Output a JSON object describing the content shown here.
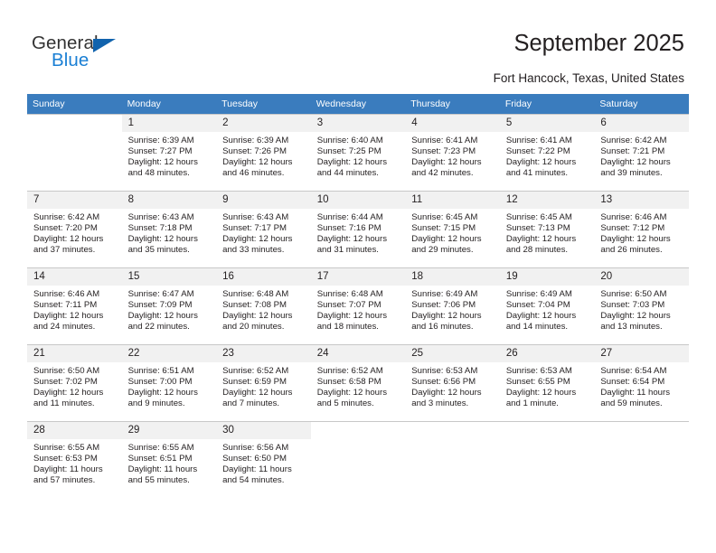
{
  "logo": {
    "word_one": "General",
    "word_two": "Blue",
    "icon": "triangle-logo-mark"
  },
  "header": {
    "title": "September 2025",
    "subtitle": "Fort Hancock, Texas, United States"
  },
  "colors": {
    "header_row_bg": "#3a7cbe",
    "daynum_bg": "#f1f1f1",
    "brand_blue": "#1a7fd4",
    "text": "#231f20"
  },
  "weekdays": [
    "Sunday",
    "Monday",
    "Tuesday",
    "Wednesday",
    "Thursday",
    "Friday",
    "Saturday"
  ],
  "labels": {
    "sunrise": "Sunrise:",
    "sunset": "Sunset:",
    "daylight": "Daylight:"
  },
  "weeks": [
    [
      {
        "day": "",
        "sunrise": "",
        "sunset": "",
        "daylight_a": "",
        "daylight_b": "",
        "empty": true
      },
      {
        "day": "1",
        "sunrise": "Sunrise: 6:39 AM",
        "sunset": "Sunset: 7:27 PM",
        "daylight_a": "Daylight: 12 hours",
        "daylight_b": "and 48 minutes."
      },
      {
        "day": "2",
        "sunrise": "Sunrise: 6:39 AM",
        "sunset": "Sunset: 7:26 PM",
        "daylight_a": "Daylight: 12 hours",
        "daylight_b": "and 46 minutes."
      },
      {
        "day": "3",
        "sunrise": "Sunrise: 6:40 AM",
        "sunset": "Sunset: 7:25 PM",
        "daylight_a": "Daylight: 12 hours",
        "daylight_b": "and 44 minutes."
      },
      {
        "day": "4",
        "sunrise": "Sunrise: 6:41 AM",
        "sunset": "Sunset: 7:23 PM",
        "daylight_a": "Daylight: 12 hours",
        "daylight_b": "and 42 minutes."
      },
      {
        "day": "5",
        "sunrise": "Sunrise: 6:41 AM",
        "sunset": "Sunset: 7:22 PM",
        "daylight_a": "Daylight: 12 hours",
        "daylight_b": "and 41 minutes."
      },
      {
        "day": "6",
        "sunrise": "Sunrise: 6:42 AM",
        "sunset": "Sunset: 7:21 PM",
        "daylight_a": "Daylight: 12 hours",
        "daylight_b": "and 39 minutes."
      }
    ],
    [
      {
        "day": "7",
        "sunrise": "Sunrise: 6:42 AM",
        "sunset": "Sunset: 7:20 PM",
        "daylight_a": "Daylight: 12 hours",
        "daylight_b": "and 37 minutes."
      },
      {
        "day": "8",
        "sunrise": "Sunrise: 6:43 AM",
        "sunset": "Sunset: 7:18 PM",
        "daylight_a": "Daylight: 12 hours",
        "daylight_b": "and 35 minutes."
      },
      {
        "day": "9",
        "sunrise": "Sunrise: 6:43 AM",
        "sunset": "Sunset: 7:17 PM",
        "daylight_a": "Daylight: 12 hours",
        "daylight_b": "and 33 minutes."
      },
      {
        "day": "10",
        "sunrise": "Sunrise: 6:44 AM",
        "sunset": "Sunset: 7:16 PM",
        "daylight_a": "Daylight: 12 hours",
        "daylight_b": "and 31 minutes."
      },
      {
        "day": "11",
        "sunrise": "Sunrise: 6:45 AM",
        "sunset": "Sunset: 7:15 PM",
        "daylight_a": "Daylight: 12 hours",
        "daylight_b": "and 29 minutes."
      },
      {
        "day": "12",
        "sunrise": "Sunrise: 6:45 AM",
        "sunset": "Sunset: 7:13 PM",
        "daylight_a": "Daylight: 12 hours",
        "daylight_b": "and 28 minutes."
      },
      {
        "day": "13",
        "sunrise": "Sunrise: 6:46 AM",
        "sunset": "Sunset: 7:12 PM",
        "daylight_a": "Daylight: 12 hours",
        "daylight_b": "and 26 minutes."
      }
    ],
    [
      {
        "day": "14",
        "sunrise": "Sunrise: 6:46 AM",
        "sunset": "Sunset: 7:11 PM",
        "daylight_a": "Daylight: 12 hours",
        "daylight_b": "and 24 minutes."
      },
      {
        "day": "15",
        "sunrise": "Sunrise: 6:47 AM",
        "sunset": "Sunset: 7:09 PM",
        "daylight_a": "Daylight: 12 hours",
        "daylight_b": "and 22 minutes."
      },
      {
        "day": "16",
        "sunrise": "Sunrise: 6:48 AM",
        "sunset": "Sunset: 7:08 PM",
        "daylight_a": "Daylight: 12 hours",
        "daylight_b": "and 20 minutes."
      },
      {
        "day": "17",
        "sunrise": "Sunrise: 6:48 AM",
        "sunset": "Sunset: 7:07 PM",
        "daylight_a": "Daylight: 12 hours",
        "daylight_b": "and 18 minutes."
      },
      {
        "day": "18",
        "sunrise": "Sunrise: 6:49 AM",
        "sunset": "Sunset: 7:06 PM",
        "daylight_a": "Daylight: 12 hours",
        "daylight_b": "and 16 minutes."
      },
      {
        "day": "19",
        "sunrise": "Sunrise: 6:49 AM",
        "sunset": "Sunset: 7:04 PM",
        "daylight_a": "Daylight: 12 hours",
        "daylight_b": "and 14 minutes."
      },
      {
        "day": "20",
        "sunrise": "Sunrise: 6:50 AM",
        "sunset": "Sunset: 7:03 PM",
        "daylight_a": "Daylight: 12 hours",
        "daylight_b": "and 13 minutes."
      }
    ],
    [
      {
        "day": "21",
        "sunrise": "Sunrise: 6:50 AM",
        "sunset": "Sunset: 7:02 PM",
        "daylight_a": "Daylight: 12 hours",
        "daylight_b": "and 11 minutes."
      },
      {
        "day": "22",
        "sunrise": "Sunrise: 6:51 AM",
        "sunset": "Sunset: 7:00 PM",
        "daylight_a": "Daylight: 12 hours",
        "daylight_b": "and 9 minutes."
      },
      {
        "day": "23",
        "sunrise": "Sunrise: 6:52 AM",
        "sunset": "Sunset: 6:59 PM",
        "daylight_a": "Daylight: 12 hours",
        "daylight_b": "and 7 minutes."
      },
      {
        "day": "24",
        "sunrise": "Sunrise: 6:52 AM",
        "sunset": "Sunset: 6:58 PM",
        "daylight_a": "Daylight: 12 hours",
        "daylight_b": "and 5 minutes."
      },
      {
        "day": "25",
        "sunrise": "Sunrise: 6:53 AM",
        "sunset": "Sunset: 6:56 PM",
        "daylight_a": "Daylight: 12 hours",
        "daylight_b": "and 3 minutes."
      },
      {
        "day": "26",
        "sunrise": "Sunrise: 6:53 AM",
        "sunset": "Sunset: 6:55 PM",
        "daylight_a": "Daylight: 12 hours",
        "daylight_b": "and 1 minute."
      },
      {
        "day": "27",
        "sunrise": "Sunrise: 6:54 AM",
        "sunset": "Sunset: 6:54 PM",
        "daylight_a": "Daylight: 11 hours",
        "daylight_b": "and 59 minutes."
      }
    ],
    [
      {
        "day": "28",
        "sunrise": "Sunrise: 6:55 AM",
        "sunset": "Sunset: 6:53 PM",
        "daylight_a": "Daylight: 11 hours",
        "daylight_b": "and 57 minutes."
      },
      {
        "day": "29",
        "sunrise": "Sunrise: 6:55 AM",
        "sunset": "Sunset: 6:51 PM",
        "daylight_a": "Daylight: 11 hours",
        "daylight_b": "and 55 minutes."
      },
      {
        "day": "30",
        "sunrise": "Sunrise: 6:56 AM",
        "sunset": "Sunset: 6:50 PM",
        "daylight_a": "Daylight: 11 hours",
        "daylight_b": "and 54 minutes."
      },
      {
        "day": "",
        "sunrise": "",
        "sunset": "",
        "daylight_a": "",
        "daylight_b": "",
        "empty": true
      },
      {
        "day": "",
        "sunrise": "",
        "sunset": "",
        "daylight_a": "",
        "daylight_b": "",
        "empty": true
      },
      {
        "day": "",
        "sunrise": "",
        "sunset": "",
        "daylight_a": "",
        "daylight_b": "",
        "empty": true
      },
      {
        "day": "",
        "sunrise": "",
        "sunset": "",
        "daylight_a": "",
        "daylight_b": "",
        "empty": true
      }
    ]
  ]
}
